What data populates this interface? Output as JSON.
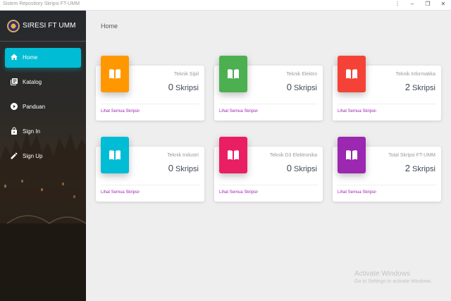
{
  "window": {
    "title": "Sistem Repository Skripsi FT-UMM",
    "controls": {
      "menu": "⋮",
      "minimize": "–",
      "maximize": "❐",
      "close": "✕"
    }
  },
  "sidebar": {
    "brand": "SIRESI FT UMM",
    "items": [
      {
        "label": "Home",
        "icon": "home-icon",
        "active": true
      },
      {
        "label": "Katalog",
        "icon": "library-books-icon",
        "active": false
      },
      {
        "label": "Panduan",
        "icon": "play-circle-icon",
        "active": false
      },
      {
        "label": "Sign In",
        "icon": "lock-icon",
        "active": false
      },
      {
        "label": "Sign Up",
        "icon": "pencil-icon",
        "active": false
      }
    ]
  },
  "page": {
    "title": "Home"
  },
  "cards": [
    {
      "category": "Teknik Sipil",
      "count": "0",
      "unit": "Skripsi",
      "link": "Lihat Semua Skripsi",
      "color": "#ff9800",
      "icon": "book-open-icon"
    },
    {
      "category": "Teknik Elektro",
      "count": "0",
      "unit": "Skripsi",
      "link": "Lihat Semua Skripsi",
      "color": "#4caf50",
      "icon": "book-open-icon"
    },
    {
      "category": "Teknik Informatika",
      "count": "2",
      "unit": "Skripsi",
      "link": "Lihat Semua Skripsi",
      "color": "#f44336",
      "icon": "book-open-icon"
    },
    {
      "category": "Teknik Industri",
      "count": "0",
      "unit": "Skripsi",
      "link": "Lihat Semua Skripsi",
      "color": "#00bcd4",
      "icon": "book-open-icon"
    },
    {
      "category": "Teknik D3 Elektronika",
      "count": "0",
      "unit": "Skripsi",
      "link": "Lihat Semua Skripsi",
      "color": "#e91e63",
      "icon": "book-open-icon"
    },
    {
      "category": "Total Skripsi FT-UMM",
      "count": "2",
      "unit": "Skripsi",
      "link": "Lihat Semua Skripsi",
      "color": "#9c27b0",
      "icon": "book-open-icon"
    }
  ],
  "watermark": {
    "line1": "Activate Windows",
    "line2": "Go to Settings to activate Windows."
  }
}
